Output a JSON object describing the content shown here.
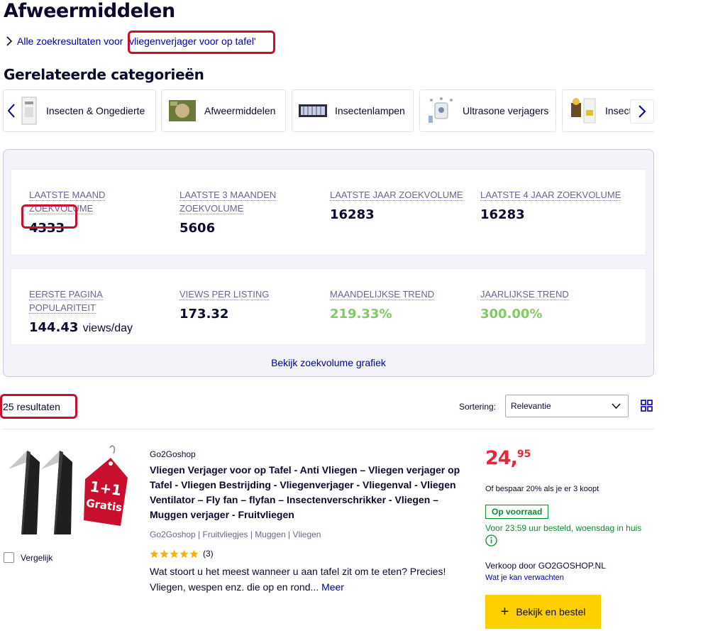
{
  "page": {
    "title": "Afweermiddelen"
  },
  "search_link": {
    "prefix": "Alle zoekresultaten voor",
    "query": "'vliegenverjager voor op tafel'"
  },
  "related": {
    "title": "Gerelateerde categorieën",
    "categories": [
      {
        "label": "Insecten & Ongedierte",
        "icon": "insect-product-thumbnail"
      },
      {
        "label": "Afweermiddelen",
        "icon": "repellent-box-thumbnail"
      },
      {
        "label": "Insectenlampen",
        "icon": "insect-lamp-thumbnail"
      },
      {
        "label": "Ultrasone verjagers",
        "icon": "ultrasonic-repeller-thumbnail"
      },
      {
        "label": "Insect",
        "icon": "trap-products-thumbnail"
      }
    ]
  },
  "insights": {
    "row1": [
      {
        "label": "LAATSTE MAAND ZOEKVOLUME",
        "value": "4333"
      },
      {
        "label": "LAATSTE 3 MAANDEN ZOEKVOLUME",
        "value": "5606"
      },
      {
        "label": "LAATSTE JAAR ZOEKVOLUME",
        "value": "16283"
      },
      {
        "label": "LAATSTE 4 JAAR ZOEKVOLUME",
        "value": "16283"
      }
    ],
    "row2": [
      {
        "label": "EERSTE PAGINA POPULARITEIT",
        "value": "144.43",
        "unit": "views/day"
      },
      {
        "label": "VIEWS PER LISTING",
        "value": "173.32"
      },
      {
        "label": "MAANDELIJKSE TREND",
        "value": "219.33%"
      },
      {
        "label": "JAARLIJKSE TREND",
        "value": "300.00%"
      }
    ],
    "chart_link": "Bekijk zoekvolume grafiek",
    "trend_color": "#7fcc5f"
  },
  "results": {
    "count": "25 resultaten",
    "sort_label": "Sortering:",
    "sort_value": "Relevantie"
  },
  "product": {
    "seller": "Go2Goshop",
    "title": "Vliegen Verjager voor op Tafel - Anti Vliegen – Vliegen verjager op Tafel - Vliegen Bestrijding - Vliegenverjager - Vliegenval - Vliegen Ventilator – Fly fan – flyfan – Insectenverschrikker - Vliegen – Muggen verjager - Fruitvliegen",
    "breadcrumbs": "Go2Goshop | Fruitvliegjes | Muggen | Vliegen",
    "rating": 5,
    "rating_count": "(3)",
    "description": "Wat stoort u het meest wanneer u aan tafel zit om te eten? Precies! Vliegen, wespen enz. die op en rond...",
    "more": "Meer",
    "compare_label": "Vergelijk",
    "price_main": "24,",
    "price_cents": "95",
    "discount": "Of bespaar 20% als je er 3 koopt",
    "stock": "Op voorraad",
    "delivery": "Voor 23:59 uur besteld, woensdag in huis",
    "sold_by": "Verkoop door GO2GOSHOP.NL",
    "expect_link": "Wat je kan verwachten",
    "buy_label": "Bekijk en bestel",
    "tag_text_1": "1+1",
    "tag_text_2": "Gratis",
    "price_color": "#e0293b",
    "stock_color": "#0c8c2e",
    "button_color": "#ffd000"
  },
  "highlight_color": "#c8102e"
}
